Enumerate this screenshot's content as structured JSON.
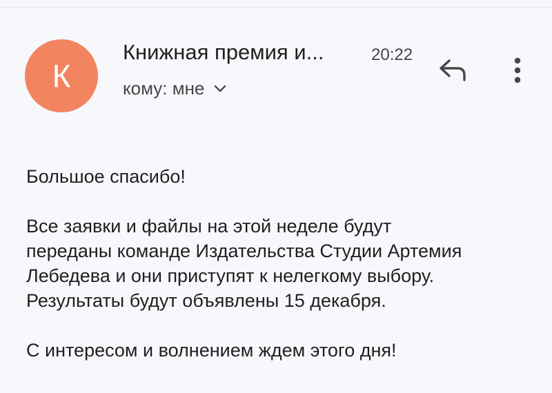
{
  "message": {
    "avatar": {
      "letter": "К",
      "color": "#f2845f"
    },
    "sender": "Книжная премия и...",
    "time": "20:22",
    "recipient_label": "кому: мне",
    "icons": {
      "expand": "chevron-down-icon",
      "reply": "reply-icon",
      "more": "more-vert-icon"
    },
    "body": {
      "greeting": "Большое спасибо!",
      "line1": "Все заявки и файлы на этой неделе будут",
      "line2": "переданы команде Издательства Студии Артемия",
      "line3": "Лебедева и они приступят к нелегкому выбору.",
      "line4": "Результаты будут объявлены 15 декабря.",
      "closing": "С интересом и волнением ждем этого дня!"
    }
  }
}
